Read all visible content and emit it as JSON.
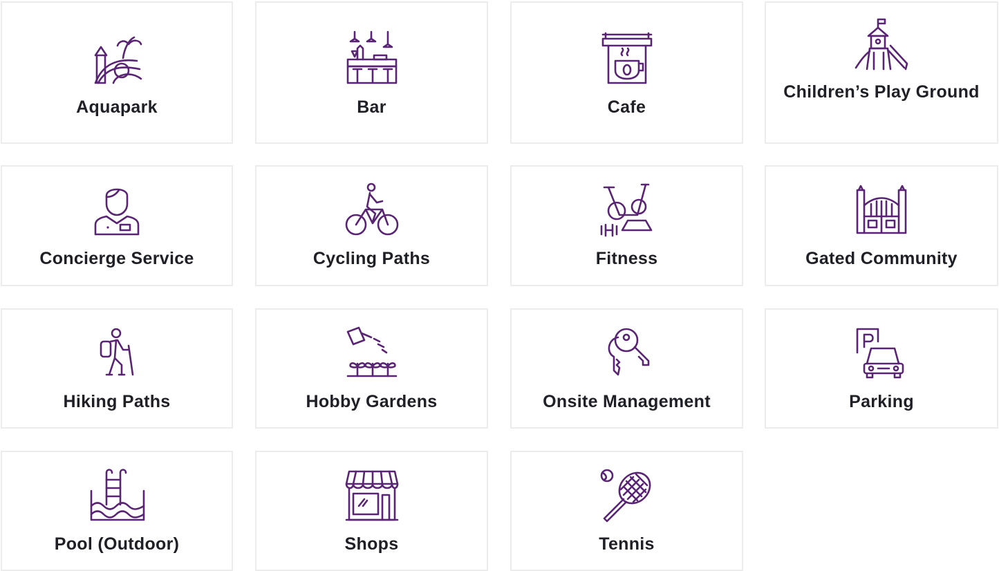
{
  "accent_color": "#5a2474",
  "amenities": [
    {
      "label": "Aquapark",
      "icon": "aquapark-icon"
    },
    {
      "label": "Bar",
      "icon": "bar-icon"
    },
    {
      "label": "Cafe",
      "icon": "cafe-icon"
    },
    {
      "label": "Children’s Play Ground",
      "icon": "playground-icon"
    },
    {
      "label": "Concierge Service",
      "icon": "concierge-icon"
    },
    {
      "label": "Cycling Paths",
      "icon": "cyclist-icon"
    },
    {
      "label": "Fitness",
      "icon": "exercise-bike-icon"
    },
    {
      "label": "Gated Community",
      "icon": "gate-icon"
    },
    {
      "label": "Hiking Paths",
      "icon": "hiker-icon"
    },
    {
      "label": "Hobby Gardens",
      "icon": "watering-can-icon"
    },
    {
      "label": "Onsite Management",
      "icon": "keys-icon"
    },
    {
      "label": "Parking",
      "icon": "parking-car-icon"
    },
    {
      "label": "Pool (Outdoor)",
      "icon": "pool-ladder-icon"
    },
    {
      "label": "Shops",
      "icon": "storefront-icon"
    },
    {
      "label": "Tennis",
      "icon": "tennis-racket-icon"
    }
  ]
}
